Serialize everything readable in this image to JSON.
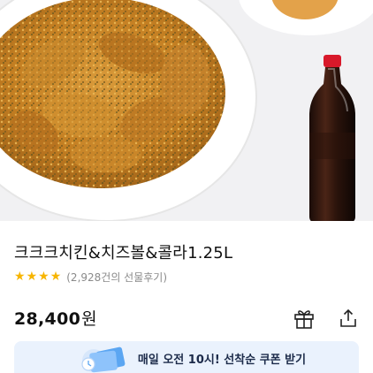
{
  "product": {
    "title": "크크크치킨&치즈볼&콜라1.25L",
    "rating": {
      "stars": 4,
      "max_stars": 5,
      "review_text": "(2,928건의 선물후기)"
    },
    "price": {
      "amount": "28,400",
      "currency": "원"
    }
  },
  "actions": {
    "gift_icon": "gift-icon",
    "share_icon": "share-icon"
  },
  "coupon": {
    "text": "매일 오전 10시! 선착순 쿠폰 받기"
  },
  "colors": {
    "star": "#f7b500",
    "coupon_bg": "#eaf2fd",
    "coupon_text": "#1c2b4a"
  }
}
